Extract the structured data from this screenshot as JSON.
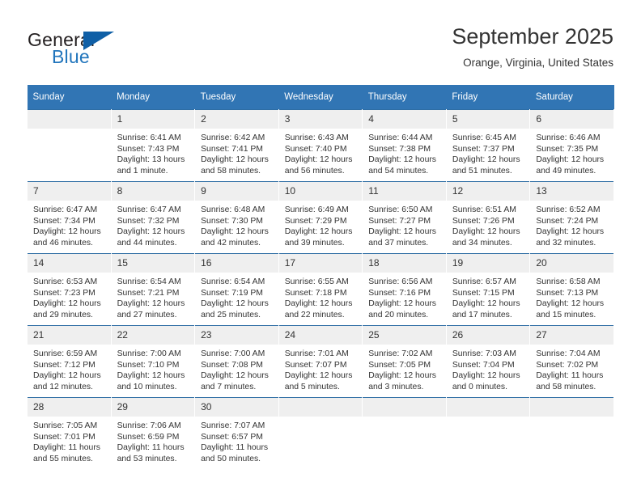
{
  "branding": {
    "logo_word_1": "General",
    "logo_word_2": "Blue",
    "logo_color_dark": "#231f20",
    "logo_color_blue": "#2175bc",
    "triangle_color": "#0f5fa6"
  },
  "header": {
    "month_title": "September 2025",
    "location": "Orange, Virginia, United States"
  },
  "theme": {
    "header_row_bg": "#3175b4",
    "header_row_text": "#ffffff",
    "daynum_bg": "#efefef",
    "row_divider": "#2e6da4",
    "body_text": "#333333"
  },
  "calendar": {
    "weekday_headers": [
      "Sunday",
      "Monday",
      "Tuesday",
      "Wednesday",
      "Thursday",
      "Friday",
      "Saturday"
    ],
    "weeks": [
      [
        {
          "day": "",
          "sunrise": "",
          "sunset": "",
          "daylight": "",
          "empty": true
        },
        {
          "day": "1",
          "sunrise": "Sunrise: 6:41 AM",
          "sunset": "Sunset: 7:43 PM",
          "daylight": "Daylight: 13 hours and 1 minute."
        },
        {
          "day": "2",
          "sunrise": "Sunrise: 6:42 AM",
          "sunset": "Sunset: 7:41 PM",
          "daylight": "Daylight: 12 hours and 58 minutes."
        },
        {
          "day": "3",
          "sunrise": "Sunrise: 6:43 AM",
          "sunset": "Sunset: 7:40 PM",
          "daylight": "Daylight: 12 hours and 56 minutes."
        },
        {
          "day": "4",
          "sunrise": "Sunrise: 6:44 AM",
          "sunset": "Sunset: 7:38 PM",
          "daylight": "Daylight: 12 hours and 54 minutes."
        },
        {
          "day": "5",
          "sunrise": "Sunrise: 6:45 AM",
          "sunset": "Sunset: 7:37 PM",
          "daylight": "Daylight: 12 hours and 51 minutes."
        },
        {
          "day": "6",
          "sunrise": "Sunrise: 6:46 AM",
          "sunset": "Sunset: 7:35 PM",
          "daylight": "Daylight: 12 hours and 49 minutes."
        }
      ],
      [
        {
          "day": "7",
          "sunrise": "Sunrise: 6:47 AM",
          "sunset": "Sunset: 7:34 PM",
          "daylight": "Daylight: 12 hours and 46 minutes."
        },
        {
          "day": "8",
          "sunrise": "Sunrise: 6:47 AM",
          "sunset": "Sunset: 7:32 PM",
          "daylight": "Daylight: 12 hours and 44 minutes."
        },
        {
          "day": "9",
          "sunrise": "Sunrise: 6:48 AM",
          "sunset": "Sunset: 7:30 PM",
          "daylight": "Daylight: 12 hours and 42 minutes."
        },
        {
          "day": "10",
          "sunrise": "Sunrise: 6:49 AM",
          "sunset": "Sunset: 7:29 PM",
          "daylight": "Daylight: 12 hours and 39 minutes."
        },
        {
          "day": "11",
          "sunrise": "Sunrise: 6:50 AM",
          "sunset": "Sunset: 7:27 PM",
          "daylight": "Daylight: 12 hours and 37 minutes."
        },
        {
          "day": "12",
          "sunrise": "Sunrise: 6:51 AM",
          "sunset": "Sunset: 7:26 PM",
          "daylight": "Daylight: 12 hours and 34 minutes."
        },
        {
          "day": "13",
          "sunrise": "Sunrise: 6:52 AM",
          "sunset": "Sunset: 7:24 PM",
          "daylight": "Daylight: 12 hours and 32 minutes."
        }
      ],
      [
        {
          "day": "14",
          "sunrise": "Sunrise: 6:53 AM",
          "sunset": "Sunset: 7:23 PM",
          "daylight": "Daylight: 12 hours and 29 minutes."
        },
        {
          "day": "15",
          "sunrise": "Sunrise: 6:54 AM",
          "sunset": "Sunset: 7:21 PM",
          "daylight": "Daylight: 12 hours and 27 minutes."
        },
        {
          "day": "16",
          "sunrise": "Sunrise: 6:54 AM",
          "sunset": "Sunset: 7:19 PM",
          "daylight": "Daylight: 12 hours and 25 minutes."
        },
        {
          "day": "17",
          "sunrise": "Sunrise: 6:55 AM",
          "sunset": "Sunset: 7:18 PM",
          "daylight": "Daylight: 12 hours and 22 minutes."
        },
        {
          "day": "18",
          "sunrise": "Sunrise: 6:56 AM",
          "sunset": "Sunset: 7:16 PM",
          "daylight": "Daylight: 12 hours and 20 minutes."
        },
        {
          "day": "19",
          "sunrise": "Sunrise: 6:57 AM",
          "sunset": "Sunset: 7:15 PM",
          "daylight": "Daylight: 12 hours and 17 minutes."
        },
        {
          "day": "20",
          "sunrise": "Sunrise: 6:58 AM",
          "sunset": "Sunset: 7:13 PM",
          "daylight": "Daylight: 12 hours and 15 minutes."
        }
      ],
      [
        {
          "day": "21",
          "sunrise": "Sunrise: 6:59 AM",
          "sunset": "Sunset: 7:12 PM",
          "daylight": "Daylight: 12 hours and 12 minutes."
        },
        {
          "day": "22",
          "sunrise": "Sunrise: 7:00 AM",
          "sunset": "Sunset: 7:10 PM",
          "daylight": "Daylight: 12 hours and 10 minutes."
        },
        {
          "day": "23",
          "sunrise": "Sunrise: 7:00 AM",
          "sunset": "Sunset: 7:08 PM",
          "daylight": "Daylight: 12 hours and 7 minutes."
        },
        {
          "day": "24",
          "sunrise": "Sunrise: 7:01 AM",
          "sunset": "Sunset: 7:07 PM",
          "daylight": "Daylight: 12 hours and 5 minutes."
        },
        {
          "day": "25",
          "sunrise": "Sunrise: 7:02 AM",
          "sunset": "Sunset: 7:05 PM",
          "daylight": "Daylight: 12 hours and 3 minutes."
        },
        {
          "day": "26",
          "sunrise": "Sunrise: 7:03 AM",
          "sunset": "Sunset: 7:04 PM",
          "daylight": "Daylight: 12 hours and 0 minutes."
        },
        {
          "day": "27",
          "sunrise": "Sunrise: 7:04 AM",
          "sunset": "Sunset: 7:02 PM",
          "daylight": "Daylight: 11 hours and 58 minutes."
        }
      ],
      [
        {
          "day": "28",
          "sunrise": "Sunrise: 7:05 AM",
          "sunset": "Sunset: 7:01 PM",
          "daylight": "Daylight: 11 hours and 55 minutes."
        },
        {
          "day": "29",
          "sunrise": "Sunrise: 7:06 AM",
          "sunset": "Sunset: 6:59 PM",
          "daylight": "Daylight: 11 hours and 53 minutes."
        },
        {
          "day": "30",
          "sunrise": "Sunrise: 7:07 AM",
          "sunset": "Sunset: 6:57 PM",
          "daylight": "Daylight: 11 hours and 50 minutes."
        },
        {
          "day": "",
          "sunrise": "",
          "sunset": "",
          "daylight": "",
          "empty": true
        },
        {
          "day": "",
          "sunrise": "",
          "sunset": "",
          "daylight": "",
          "empty": true
        },
        {
          "day": "",
          "sunrise": "",
          "sunset": "",
          "daylight": "",
          "empty": true
        },
        {
          "day": "",
          "sunrise": "",
          "sunset": "",
          "daylight": "",
          "empty": true
        }
      ]
    ]
  }
}
